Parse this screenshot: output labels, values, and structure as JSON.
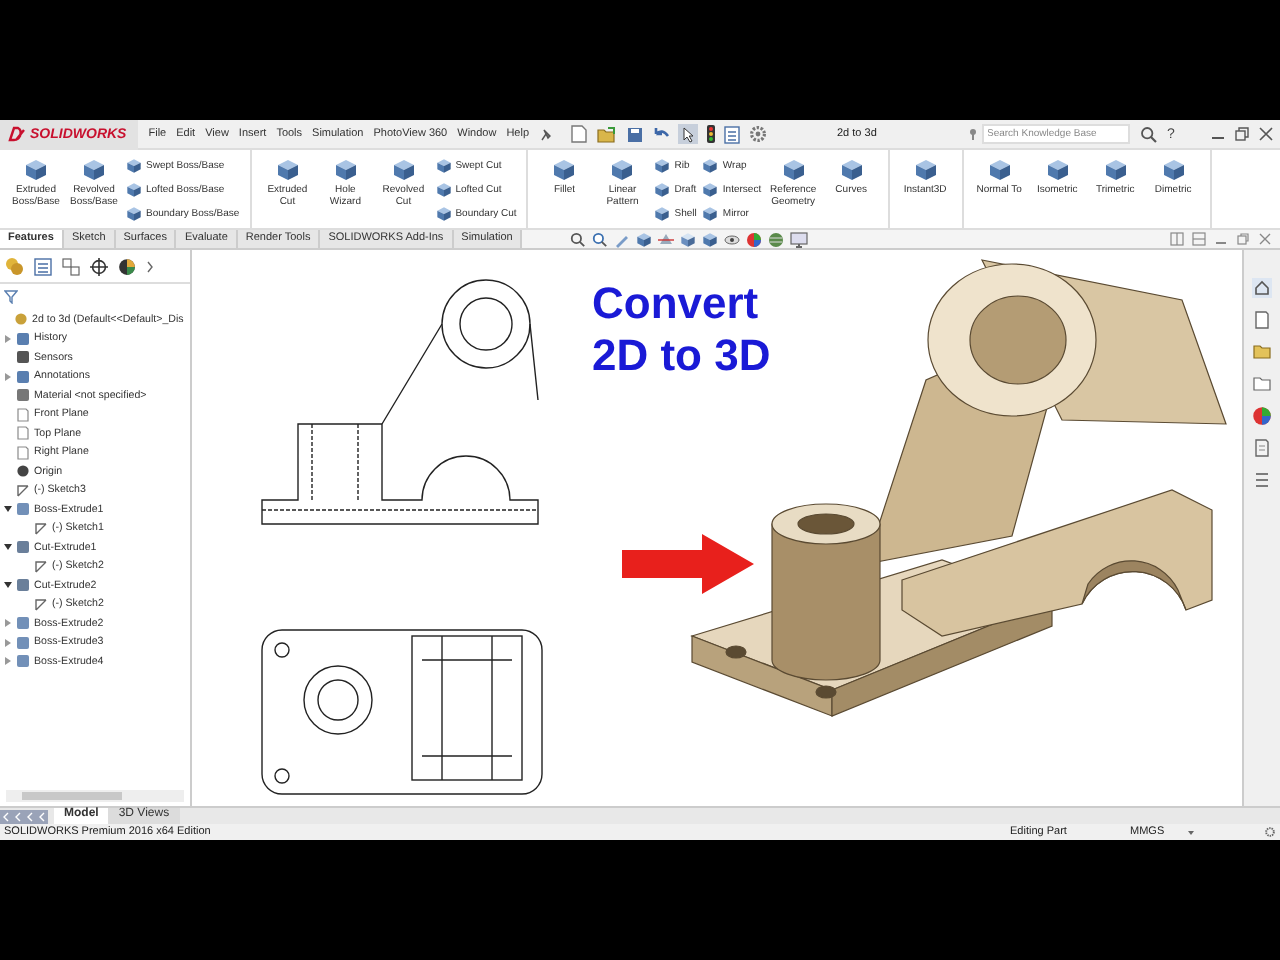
{
  "app": {
    "logo": "SOLIDWORKS",
    "menus": [
      "File",
      "Edit",
      "View",
      "Insert",
      "Tools",
      "Simulation",
      "PhotoView 360",
      "Window",
      "Help"
    ],
    "title": "2d to 3d",
    "search": {
      "placeholder": "Search Knowledge Base"
    },
    "help": "?"
  },
  "ribbon": [
    {
      "items": [
        {
          "kind": "large",
          "label": "Extruded Boss/Base"
        },
        {
          "kind": "large",
          "label": "Revolved Boss/Base"
        },
        {
          "kind": "stack",
          "labels": [
            "Swept Boss/Base",
            "Lofted Boss/Base",
            "Boundary Boss/Base"
          ]
        }
      ]
    },
    {
      "items": [
        {
          "kind": "large",
          "label": "Extruded Cut"
        },
        {
          "kind": "large",
          "label": "Hole Wizard"
        },
        {
          "kind": "large",
          "label": "Revolved Cut"
        },
        {
          "kind": "stack",
          "labels": [
            "Swept Cut",
            "Lofted Cut",
            "Boundary Cut"
          ]
        }
      ]
    },
    {
      "items": [
        {
          "kind": "large",
          "label": "Fillet"
        },
        {
          "kind": "large",
          "label": "Linear Pattern"
        },
        {
          "kind": "stack",
          "labels": [
            "Rib",
            "Draft",
            "Shell"
          ]
        },
        {
          "kind": "stack",
          "labels": [
            "Wrap",
            "Intersect",
            "Mirror"
          ]
        },
        {
          "kind": "large",
          "label": "Reference Geometry"
        },
        {
          "kind": "large",
          "label": "Curves"
        }
      ]
    },
    {
      "items": [
        {
          "kind": "large",
          "label": "Instant3D"
        }
      ]
    },
    {
      "items": [
        {
          "kind": "large",
          "label": "Normal To"
        },
        {
          "kind": "large",
          "label": "Isometric"
        },
        {
          "kind": "large",
          "label": "Trimetric"
        },
        {
          "kind": "large",
          "label": "Dimetric"
        }
      ]
    }
  ],
  "command_tabs": [
    {
      "label": "Features",
      "selected": true
    },
    {
      "label": "Sketch",
      "selected": false
    },
    {
      "label": "Surfaces",
      "selected": false
    },
    {
      "label": "Evaluate",
      "selected": false
    },
    {
      "label": "Render Tools",
      "selected": false
    },
    {
      "label": "SOLIDWORKS Add-Ins",
      "selected": false
    },
    {
      "label": "Simulation",
      "selected": false
    }
  ],
  "tree": {
    "items": [
      {
        "label": "2d to 3d  (Default<<Default>_Dis",
        "kind": "part",
        "children": [
          {
            "label": "History",
            "kind": "folder",
            "expanded": false
          },
          {
            "label": "Sensors",
            "kind": "sensor"
          },
          {
            "label": "Annotations",
            "kind": "annotation",
            "expanded": false
          },
          {
            "label": "Material <not specified>",
            "kind": "material"
          },
          {
            "label": "Front Plane",
            "kind": "plane"
          },
          {
            "label": "Top Plane",
            "kind": "plane"
          },
          {
            "label": "Right Plane",
            "kind": "plane"
          },
          {
            "label": "Origin",
            "kind": "origin"
          },
          {
            "label": "(-) Sketch3",
            "kind": "sketch"
          },
          {
            "label": "Boss-Extrude1",
            "kind": "boss",
            "expanded": true,
            "children": [
              {
                "label": "(-) Sketch1",
                "kind": "sketch"
              }
            ]
          },
          {
            "label": "Cut-Extrude1",
            "kind": "cut",
            "expanded": true,
            "children": [
              {
                "label": "(-) Sketch2",
                "kind": "sketch"
              }
            ]
          },
          {
            "label": "Cut-Extrude2",
            "kind": "cut",
            "expanded": true,
            "children": [
              {
                "label": "(-) Sketch2",
                "kind": "sketch"
              }
            ]
          },
          {
            "label": "Boss-Extrude2",
            "kind": "boss",
            "expanded": false
          },
          {
            "label": "Boss-Extrude3",
            "kind": "boss",
            "expanded": false
          },
          {
            "label": "Boss-Extrude4",
            "kind": "boss",
            "expanded": false
          }
        ]
      }
    ]
  },
  "canvas": {
    "heading": [
      "Convert",
      "2D to 3D"
    ]
  },
  "bottom_tabs": [
    {
      "label": "Model",
      "selected": true
    },
    {
      "label": "3D Views",
      "selected": false
    }
  ],
  "status_bar": {
    "message": "SOLIDWORKS Premium 2016 x64 Edition",
    "mode": "Editing Part",
    "units": "MMGS"
  }
}
